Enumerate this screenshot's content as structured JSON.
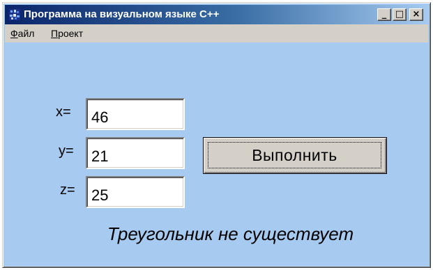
{
  "window": {
    "title": "Программа на визуальном языке С++",
    "controls": {
      "minimize": "_",
      "maximize": "□",
      "close": "×"
    }
  },
  "menu": {
    "file_mnemonic": "Ф",
    "file_rest": "айл",
    "project_mnemonic": "П",
    "project_rest": "роект"
  },
  "form": {
    "x_label": "x=",
    "x_value": "46",
    "y_label": "y=",
    "y_value": "21",
    "z_label": "z=",
    "z_value": "25",
    "run_button": "Выполнить",
    "result_text": "Треугольник не существует"
  },
  "colors": {
    "client_background": "#a6caf0",
    "titlebar_start": "#0a246a",
    "titlebar_end": "#a6caf0",
    "button_face": "#d4d0c8"
  },
  "icons": {
    "app_icon": "app-icon",
    "minimize": "minimize-icon",
    "maximize": "maximize-icon",
    "close": "close-icon"
  }
}
